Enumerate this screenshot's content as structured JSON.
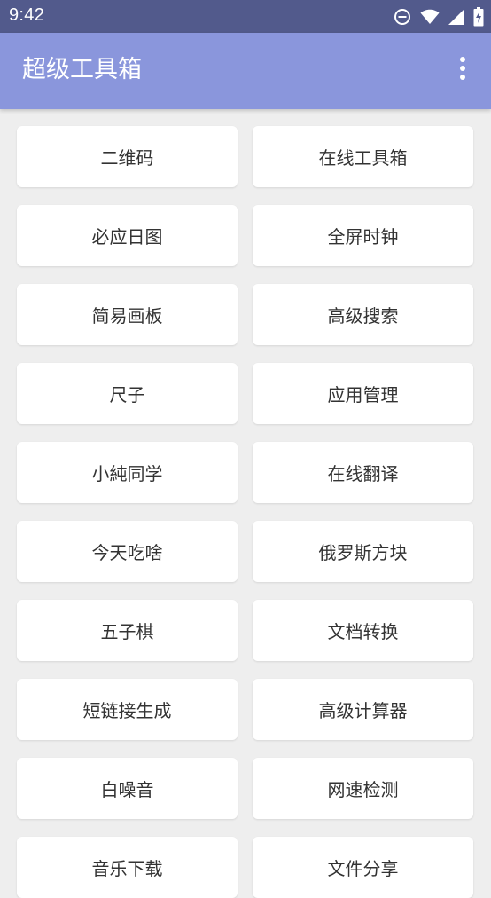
{
  "status_bar": {
    "time": "9:42",
    "icons": [
      "do-not-disturb-icon",
      "wifi-icon",
      "cellular-signal-icon",
      "battery-charging-icon"
    ]
  },
  "app_bar": {
    "title": "超级工具箱",
    "menu_icon": "more-vertical-icon"
  },
  "tools": [
    {
      "name": "二维码"
    },
    {
      "name": "在线工具箱"
    },
    {
      "name": "必应日图"
    },
    {
      "name": "全屏时钟"
    },
    {
      "name": "简易画板"
    },
    {
      "name": "高级搜索"
    },
    {
      "name": "尺子"
    },
    {
      "name": "应用管理"
    },
    {
      "name": "小純同学"
    },
    {
      "name": "在线翻译"
    },
    {
      "name": "今天吃啥"
    },
    {
      "name": "俄罗斯方块"
    },
    {
      "name": "五子棋"
    },
    {
      "name": "文档转换"
    },
    {
      "name": "短链接生成"
    },
    {
      "name": "高级计算器"
    },
    {
      "name": "白噪音"
    },
    {
      "name": "网速检测"
    },
    {
      "name": "音乐下载"
    },
    {
      "name": "文件分享"
    }
  ],
  "colors": {
    "status_bar": "#525a8c",
    "app_bar": "#8a96dc",
    "background": "#eeeeee",
    "card": "#ffffff",
    "card_text": "#333333"
  }
}
